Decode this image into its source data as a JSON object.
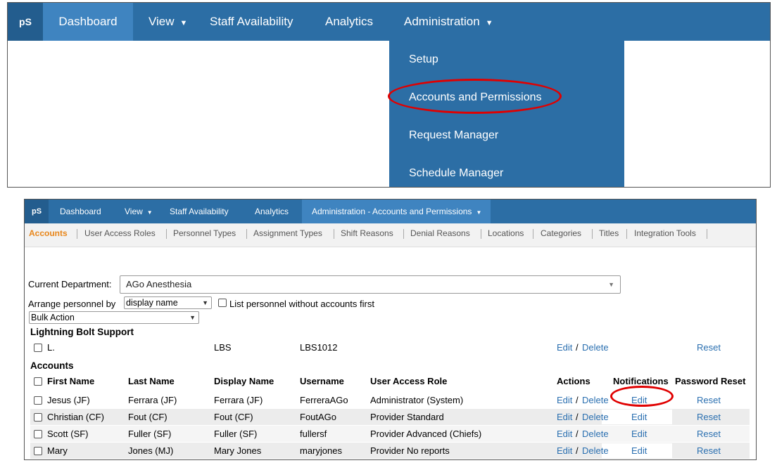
{
  "top": {
    "logo": "pS",
    "nav": [
      {
        "label": "Dashboard"
      },
      {
        "label": "View"
      },
      {
        "label": "Staff Availability"
      },
      {
        "label": "Analytics"
      },
      {
        "label": "Administration"
      }
    ],
    "dropdown": [
      "Setup",
      "Accounts and Permissions",
      "Request Manager",
      "Schedule Manager"
    ]
  },
  "bottom": {
    "logo": "pS",
    "nav": [
      {
        "label": "Dashboard"
      },
      {
        "label": "View"
      },
      {
        "label": "Staff Availability"
      },
      {
        "label": "Analytics"
      },
      {
        "label": "Administration - Accounts and Permissions"
      }
    ],
    "subnav": [
      "Accounts",
      "User Access Roles",
      "Personnel Types",
      "Assignment Types",
      "Shift Reasons",
      "Denial Reasons",
      "Locations",
      "Categories",
      "Titles",
      "Integration Tools"
    ],
    "department_label": "Current Department:",
    "department_value": "AGo Anesthesia",
    "arrange_label": "Arrange personnel by",
    "arrange_value": "display name",
    "list_without_accounts": "List personnel without accounts first",
    "bulk_action": "Bulk Action",
    "lbs_heading": "Lightning Bolt Support",
    "lbs_row": {
      "first": "L.",
      "display": "LBS",
      "username": "LBS1012",
      "edit": "Edit",
      "slash": "/",
      "delete": "Delete",
      "reset": "Reset"
    },
    "accounts_heading": "Accounts",
    "columns": {
      "first": "First Name",
      "last": "Last Name",
      "display": "Display Name",
      "username": "Username",
      "role": "User Access Role",
      "actions": "Actions",
      "notifications": "Notifications",
      "password_reset": "Password Reset"
    },
    "rows": [
      {
        "first": "Jesus (JF)",
        "last": "Ferrara (JF)",
        "display": "Ferrara (JF)",
        "username": "FerreraAGo",
        "role": "Administrator (System)",
        "edit": "Edit",
        "slash": "/",
        "delete": "Delete",
        "notif": "Edit",
        "reset": "Reset"
      },
      {
        "first": "Christian (CF)",
        "last": "Fout (CF)",
        "display": "Fout (CF)",
        "username": "FoutAGo",
        "role": "Provider Standard",
        "edit": "Edit",
        "slash": "/",
        "delete": "Delete",
        "notif": "Edit",
        "reset": "Reset"
      },
      {
        "first": "Scott (SF)",
        "last": "Fuller (SF)",
        "display": "Fuller (SF)",
        "username": "fullersf",
        "role": "Provider Advanced (Chiefs)",
        "edit": "Edit",
        "slash": "/",
        "delete": "Delete",
        "notif": "Edit",
        "reset": "Reset"
      },
      {
        "first": "Mary",
        "last": "Jones (MJ)",
        "display": "Mary Jones",
        "username": "maryjones",
        "role": "Provider No reports",
        "edit": "Edit",
        "slash": "/",
        "delete": "Delete",
        "notif": "Edit",
        "reset": "Reset"
      }
    ]
  },
  "colors": {
    "nav_bg": "#2c6ea5",
    "nav_active": "#3f84c0",
    "accent_orange": "#e8861a",
    "link_blue": "#2a6fb0",
    "highlight_red": "#e00000"
  }
}
